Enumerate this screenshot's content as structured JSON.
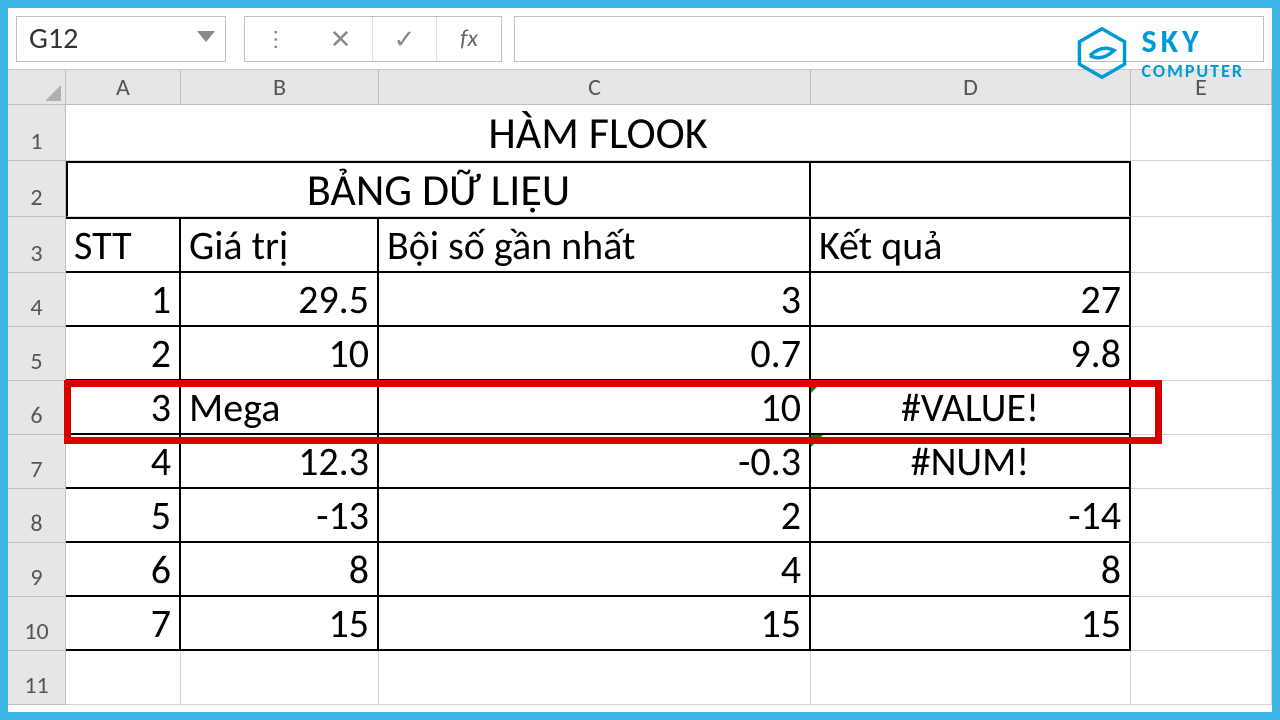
{
  "formula_bar": {
    "cell_ref": "G12",
    "fx_label": "fx",
    "formula_value": ""
  },
  "logo": {
    "top": "SKY",
    "sub": "COMPUTER"
  },
  "columns": [
    "A",
    "B",
    "C",
    "D",
    "E"
  ],
  "row_numbers": [
    "1",
    "2",
    "3",
    "4",
    "5",
    "6",
    "7",
    "8",
    "9",
    "10",
    "11"
  ],
  "title_row": "HÀM FLOOK",
  "subtitle_row": "BẢNG DỮ LIỆU",
  "headers": {
    "stt": "STT",
    "giatri": "Giá trị",
    "boiso": "Bội số gần nhất",
    "ketqua": "Kết quả"
  },
  "rows": [
    {
      "stt": "1",
      "giatri": "29.5",
      "boiso": "3",
      "ketqua": "27",
      "giatri_is_text": false,
      "ketqua_center": false
    },
    {
      "stt": "2",
      "giatri": "10",
      "boiso": "0.7",
      "ketqua": "9.8",
      "giatri_is_text": false,
      "ketqua_center": false
    },
    {
      "stt": "3",
      "giatri": "Mega",
      "boiso": "10",
      "ketqua": "#VALUE!",
      "giatri_is_text": true,
      "ketqua_center": true
    },
    {
      "stt": "4",
      "giatri": "12.3",
      "boiso": "-0.3",
      "ketqua": "#NUM!",
      "giatri_is_text": false,
      "ketqua_center": true
    },
    {
      "stt": "5",
      "giatri": "-13",
      "boiso": "2",
      "ketqua": "-14",
      "giatri_is_text": false,
      "ketqua_center": false
    },
    {
      "stt": "6",
      "giatri": "8",
      "boiso": "4",
      "ketqua": "8",
      "giatri_is_text": false,
      "ketqua_center": false
    },
    {
      "stt": "7",
      "giatri": "15",
      "boiso": "15",
      "ketqua": "15",
      "giatri_is_text": false,
      "ketqua_center": false
    }
  ],
  "chart_data": {
    "type": "table",
    "title": "HÀM FLOOK — BẢNG DỮ LIỆU",
    "columns": [
      "STT",
      "Giá trị",
      "Bội số gần nhất",
      "Kết quả"
    ],
    "rows": [
      [
        1,
        29.5,
        3,
        27
      ],
      [
        2,
        10,
        0.7,
        9.8
      ],
      [
        3,
        "Mega",
        10,
        "#VALUE!"
      ],
      [
        4,
        12.3,
        -0.3,
        "#NUM!"
      ],
      [
        5,
        -13,
        2,
        -14
      ],
      [
        6,
        8,
        4,
        8
      ],
      [
        7,
        15,
        15,
        15
      ]
    ],
    "highlighted_row_index": 4
  }
}
